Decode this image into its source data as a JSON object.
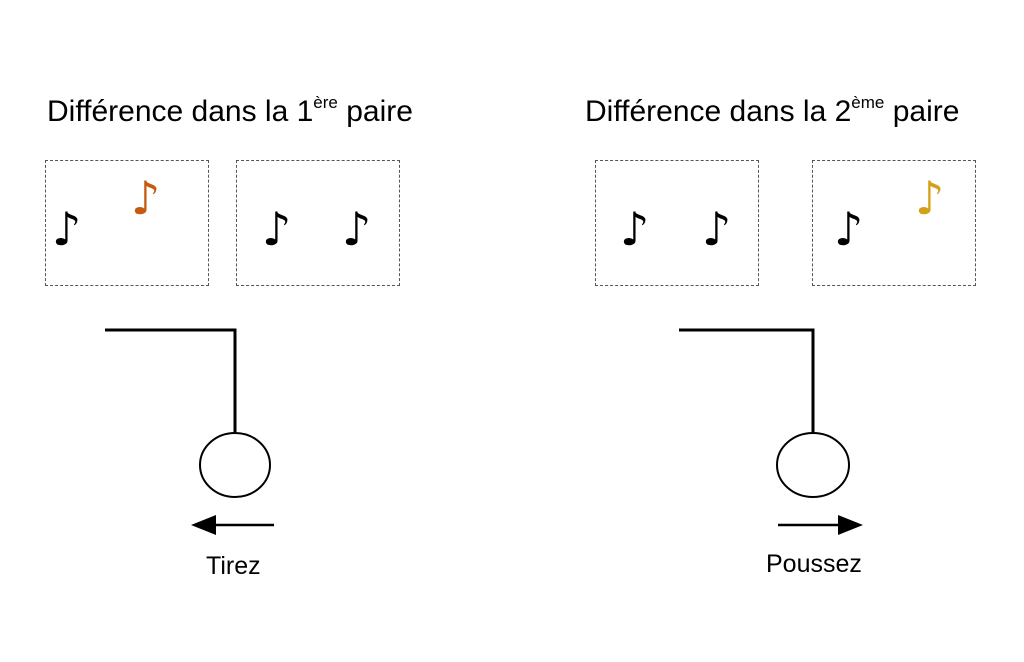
{
  "left_panel": {
    "title_main": "Différence dans la 1",
    "title_sup": "ère",
    "title_end": " paire",
    "action_label": "Tirez",
    "odd_note_color": "#c55a11"
  },
  "right_panel": {
    "title_main": "Différence dans la 2",
    "title_sup": "ème",
    "title_end": " paire",
    "action_label": "Poussez",
    "odd_note_color": "#d4a017"
  },
  "note_glyph": "♪",
  "note_color": "#000000"
}
